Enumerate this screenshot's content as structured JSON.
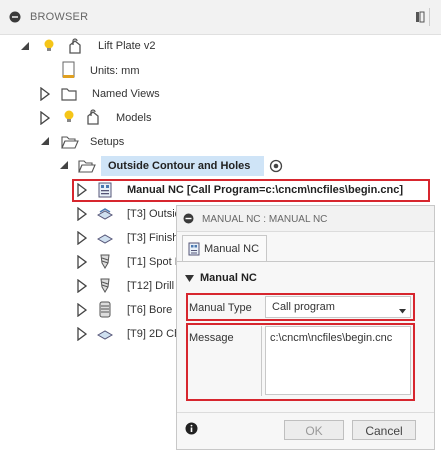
{
  "browser": {
    "title": "BROWSER",
    "tree": {
      "root_label": "Lift Plate v2",
      "units_label": "Units: mm",
      "named_views_label": "Named Views",
      "models_label": "Models",
      "setups_label": "Setups",
      "setup_label": "Outside Contour and Holes",
      "ops": [
        {
          "label": "Manual NC [Call Program=c:\\cncm\\ncfiles\\begin.cnc]"
        },
        {
          "label": "[T3] Outsid"
        },
        {
          "label": "[T3] Finish"
        },
        {
          "label": "[T1] Spot D"
        },
        {
          "label": "[T12] Drill"
        },
        {
          "label": "[T6] Bore"
        },
        {
          "label": "[T9] 2D Ch"
        }
      ]
    }
  },
  "dialog": {
    "title": "MANUAL NC : MANUAL NC",
    "tab_label": "Manual NC",
    "section_label": "Manual NC",
    "manual_type_label": "Manual Type",
    "manual_type_value": "Call program",
    "message_label": "Message",
    "message_value": "c:\\cncm\\ncfiles\\begin.cnc",
    "ok_label": "OK",
    "cancel_label": "Cancel"
  },
  "colors": {
    "highlight": "#d7262e",
    "selection": "#cfe4f7"
  }
}
